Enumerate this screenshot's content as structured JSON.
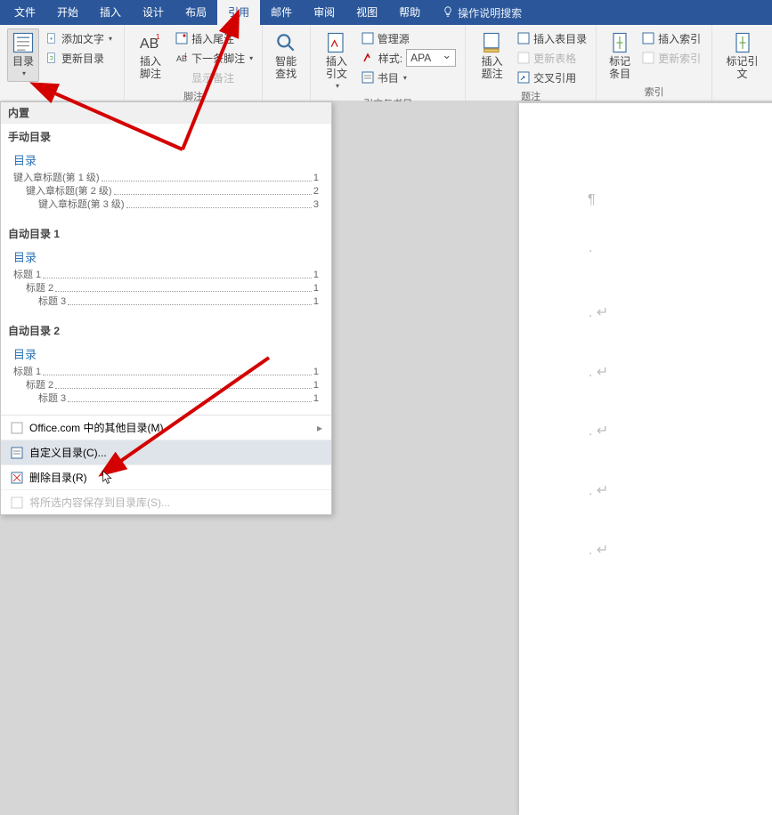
{
  "titlebar": {
    "tabs": [
      "文件",
      "开始",
      "插入",
      "设计",
      "布局",
      "引用",
      "邮件",
      "审阅",
      "视图",
      "帮助"
    ],
    "active_index": 5,
    "tell_me": "操作说明搜索"
  },
  "ribbon": {
    "toc_group": {
      "big_label": "目录",
      "add_text": "添加文字",
      "update_toc": "更新目录"
    },
    "footnote_group": {
      "big_label": "插入脚注",
      "insert_endnote": "插入尾注",
      "next_footnote": "下一条脚注",
      "show_notes": "显示备注",
      "group_label": "脚注"
    },
    "search_group": {
      "big_label": "智能\n查找"
    },
    "cite_group": {
      "big_label": "插入引文",
      "manage_sources": "管理源",
      "style_label": "样式:",
      "style_value": "APA",
      "bibliography": "书目",
      "group_label": "引文与书目"
    },
    "caption_group": {
      "big_label": "插入题注",
      "insert_tof": "插入表目录",
      "update_table": "更新表格",
      "cross_ref": "交叉引用",
      "group_label": "题注"
    },
    "index_group": {
      "big_label": "标记\n条目",
      "insert_index": "插入索引",
      "update_index": "更新索引",
      "group_label": "索引"
    },
    "toa_group": {
      "big_label": "标记引文"
    }
  },
  "dropdown": {
    "builtin": "内置",
    "manual_label": "手动目录",
    "auto1_label": "自动目录 1",
    "auto2_label": "自动目录 2",
    "toc_title": "目录",
    "manual_lines": [
      {
        "txt": "键入章标题(第 1 级)",
        "pg": "1"
      },
      {
        "txt": "键入章标题(第 2 级)",
        "pg": "2"
      },
      {
        "txt": "键入章标题(第 3 级)",
        "pg": "3"
      }
    ],
    "auto_lines": [
      {
        "txt": "标题 1",
        "pg": "1"
      },
      {
        "txt": "标题 2",
        "pg": "1"
      },
      {
        "txt": "标题 3",
        "pg": "1"
      }
    ],
    "more_office": "Office.com 中的其他目录(M)",
    "custom_toc": "自定义目录(C)...",
    "remove_toc": "删除目录(R)",
    "save_selection": "将所选内容保存到目录库(S)..."
  }
}
